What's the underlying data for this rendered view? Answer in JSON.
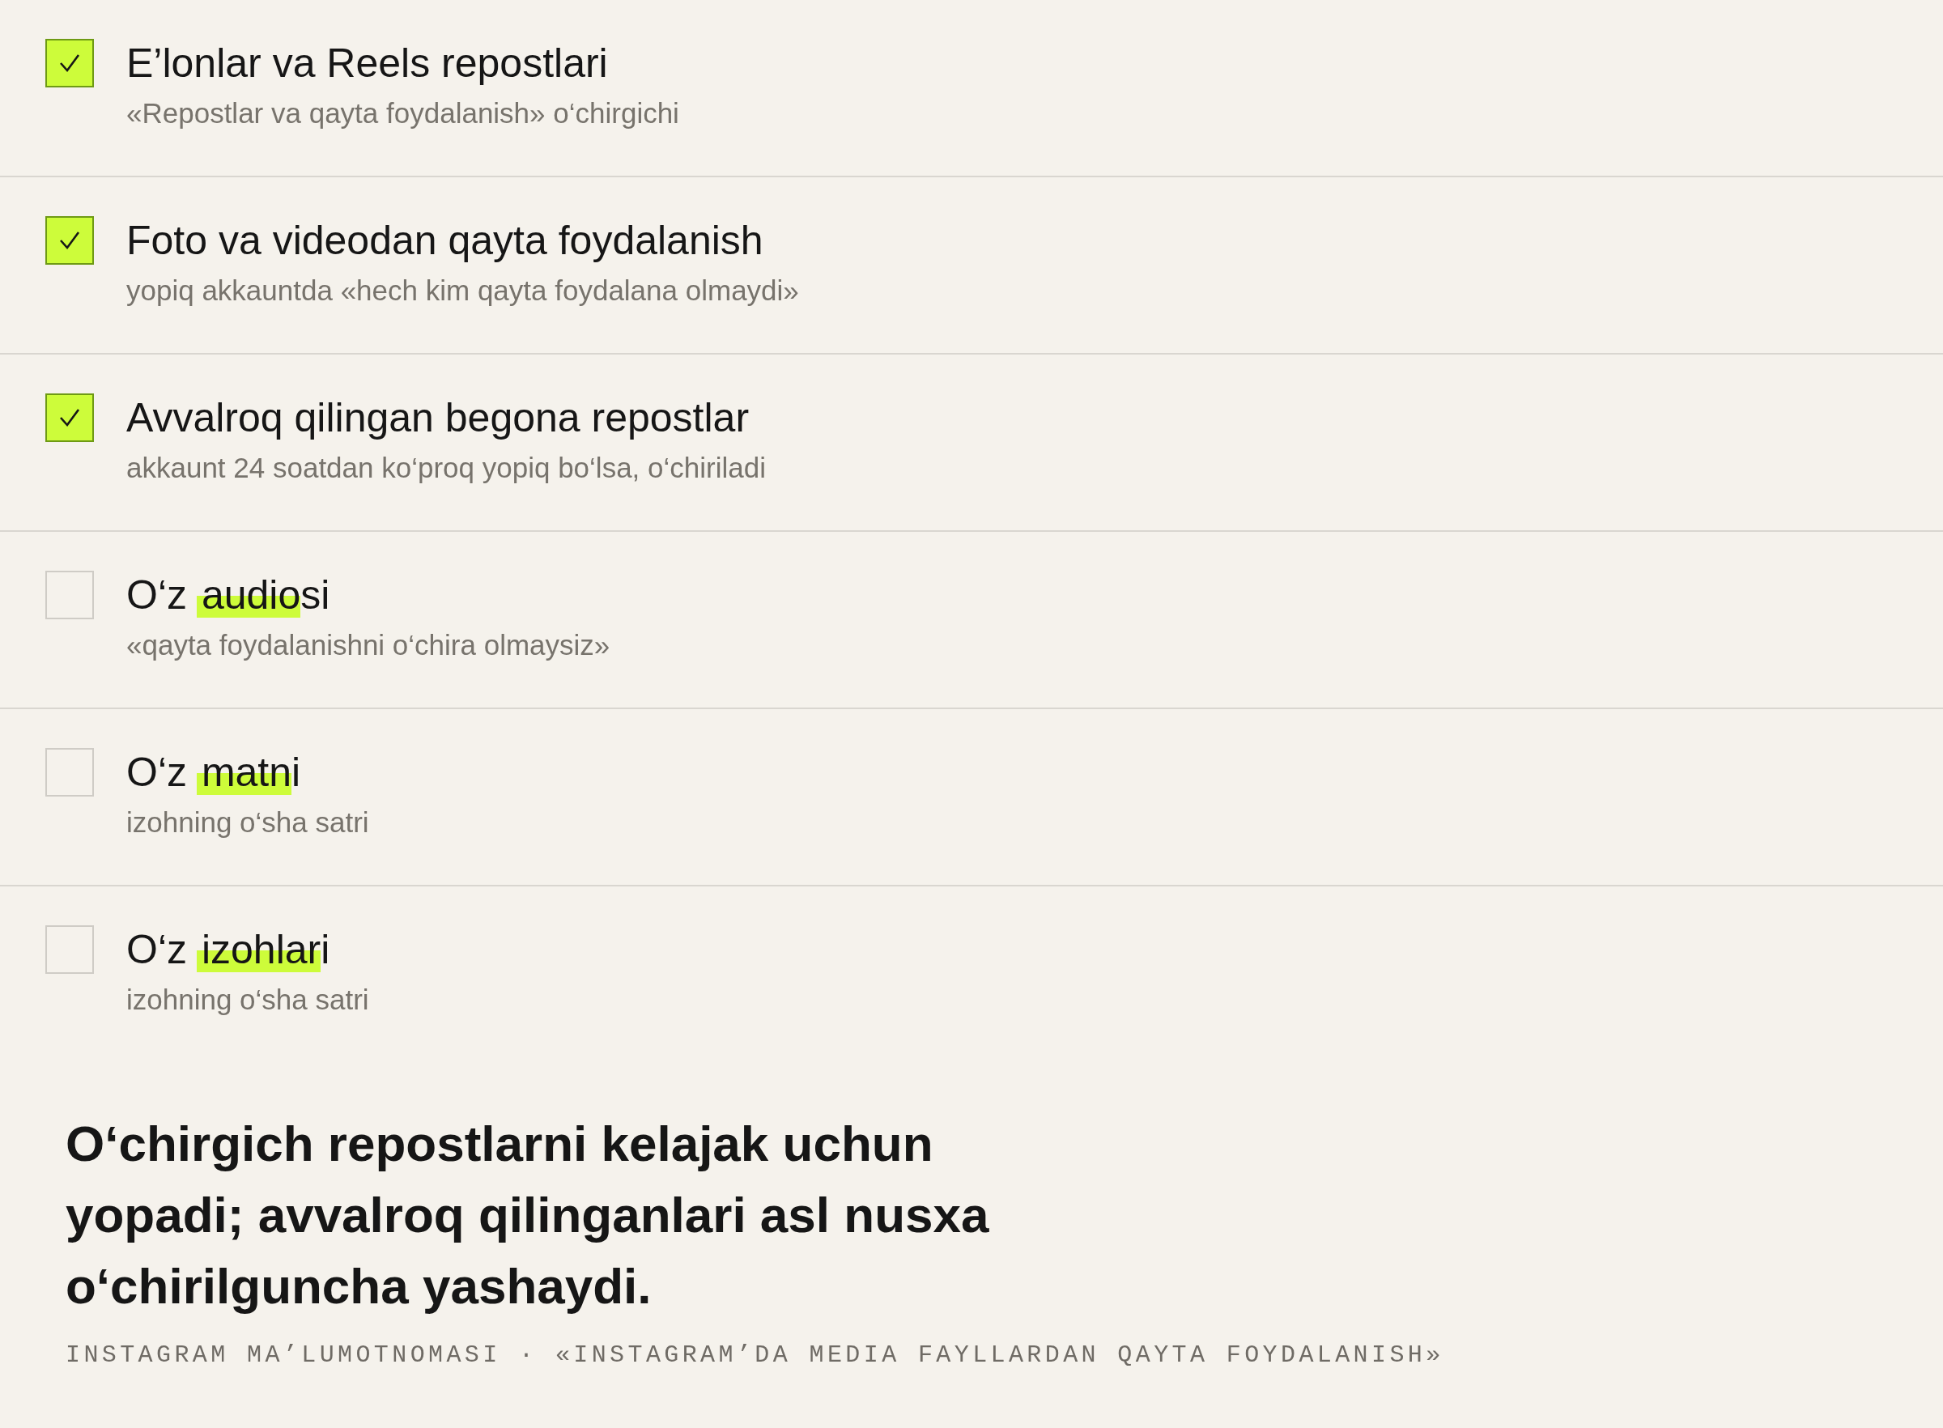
{
  "items": [
    {
      "title_parts": [
        {
          "text": "E’lonlar va Reels repostlari",
          "marked": false
        }
      ],
      "subtitle": "«Repostlar va qayta foydalanish» o‘chirgichi",
      "checked": true
    },
    {
      "title_parts": [
        {
          "text": "Foto va videodan qayta foydalanish",
          "marked": false
        }
      ],
      "subtitle": "yopiq akkauntda «hech kim qayta foydalana olmaydi»",
      "checked": true
    },
    {
      "title_parts": [
        {
          "text": "Avvalroq qilingan begona repostlar",
          "marked": false
        }
      ],
      "subtitle": "akkaunt 24 soatdan ko‘proq yopiq bo‘lsa, o‘chiriladi",
      "checked": true
    },
    {
      "title_parts": [
        {
          "text": "O‘z ",
          "marked": false
        },
        {
          "text": "audio",
          "marked": true
        },
        {
          "text": "si",
          "marked": false
        }
      ],
      "subtitle": "«qayta foydalanishni o‘chira olmaysiz»",
      "checked": false
    },
    {
      "title_parts": [
        {
          "text": "O‘z ",
          "marked": false
        },
        {
          "text": "matn",
          "marked": true
        },
        {
          "text": "i",
          "marked": false
        }
      ],
      "subtitle": "izohning o‘sha satri",
      "checked": false
    },
    {
      "title_parts": [
        {
          "text": "O‘z ",
          "marked": false
        },
        {
          "text": "izohlar",
          "marked": true
        },
        {
          "text": "i",
          "marked": false
        }
      ],
      "subtitle": "izohning o‘sha satri",
      "checked": false
    }
  ],
  "summary": "O‘chirgich repostlarni kelajak uchun yopadi; avvalroq qilinganlari asl nusxa o‘chirilguncha yashaydi.",
  "source": "INSTAGRAM MA’LUMOTNOMASI · «INSTAGRAM’DA MEDIA FAYLLARDAN QAYTA FOYDALANISH»"
}
